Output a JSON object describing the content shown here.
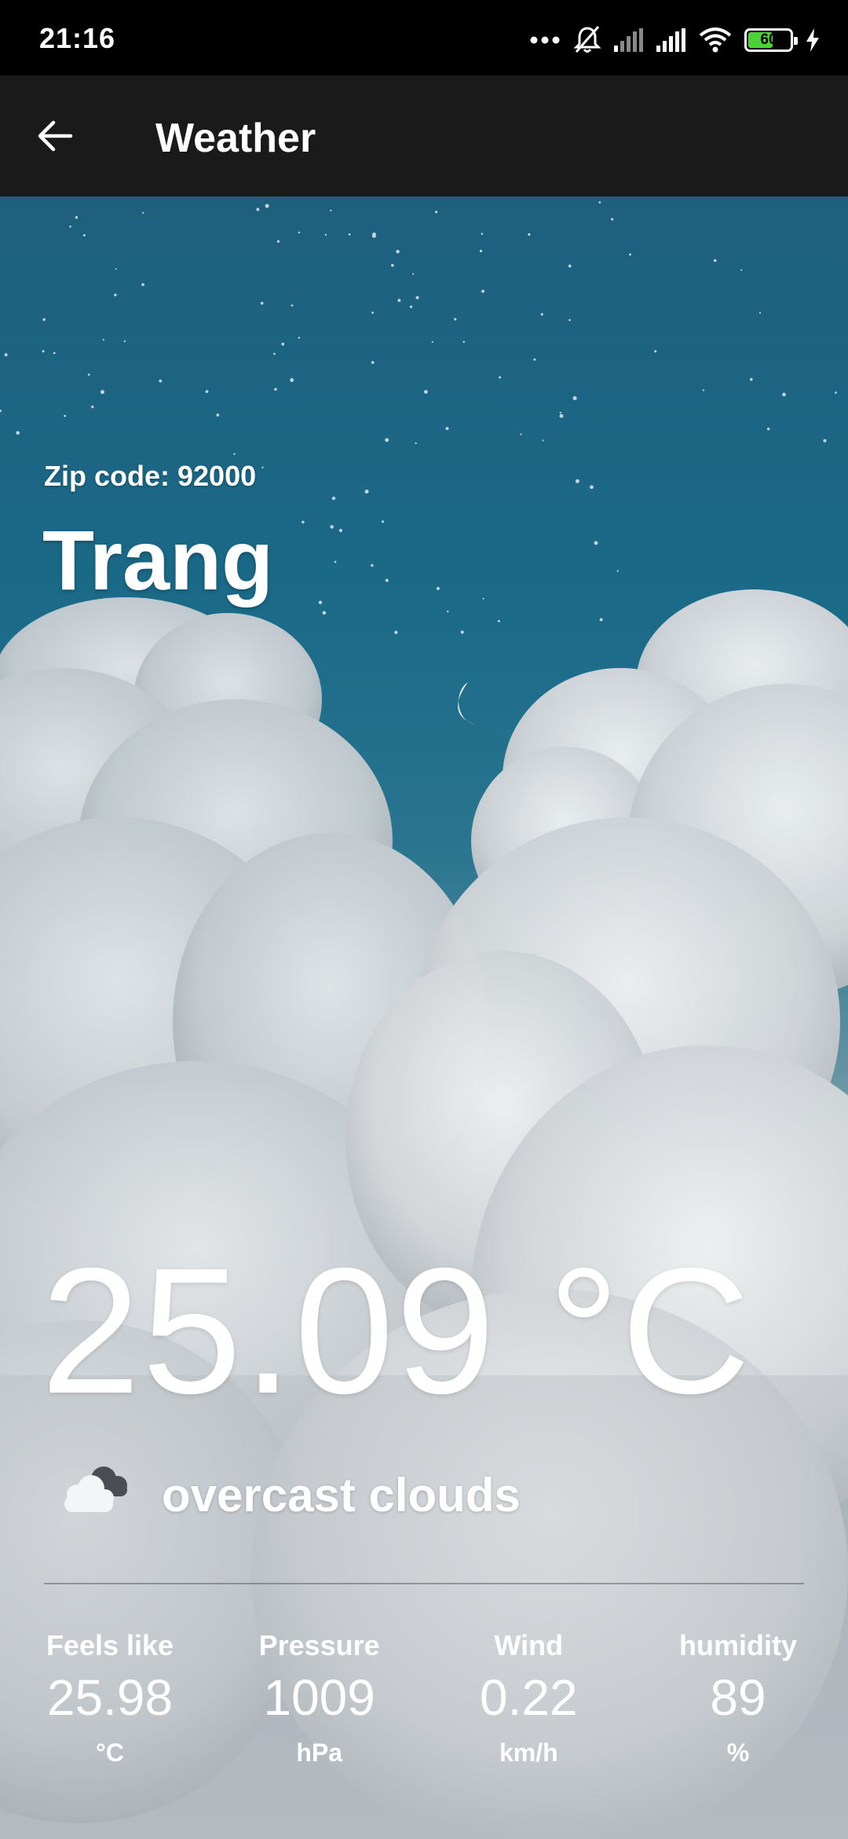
{
  "status_bar": {
    "time": "21:16",
    "battery_level": "60",
    "battery_fraction": 0.6
  },
  "app_bar": {
    "title": "Weather",
    "back_icon": "arrow-left-icon"
  },
  "location": {
    "zip_label": "Zip code: 92000",
    "city": "Trang"
  },
  "current": {
    "temperature": "25.09 °C",
    "condition": "overcast clouds",
    "condition_icon": "overcast-clouds-icon"
  },
  "stats": [
    {
      "label": "Feels like",
      "value": "25.98",
      "unit": "°C"
    },
    {
      "label": "Pressure",
      "value": "1009",
      "unit": "hPa"
    },
    {
      "label": "Wind",
      "value": "0.22",
      "unit": "km/h"
    },
    {
      "label": "humidity",
      "value": "89",
      "unit": "%"
    }
  ],
  "colors": {
    "status_bar_bg": "#000000",
    "app_bar_bg": "#1a1a1a",
    "sky_top": "#1e5f7e",
    "text": "#ffffff",
    "battery_fill": "#4cd137"
  }
}
